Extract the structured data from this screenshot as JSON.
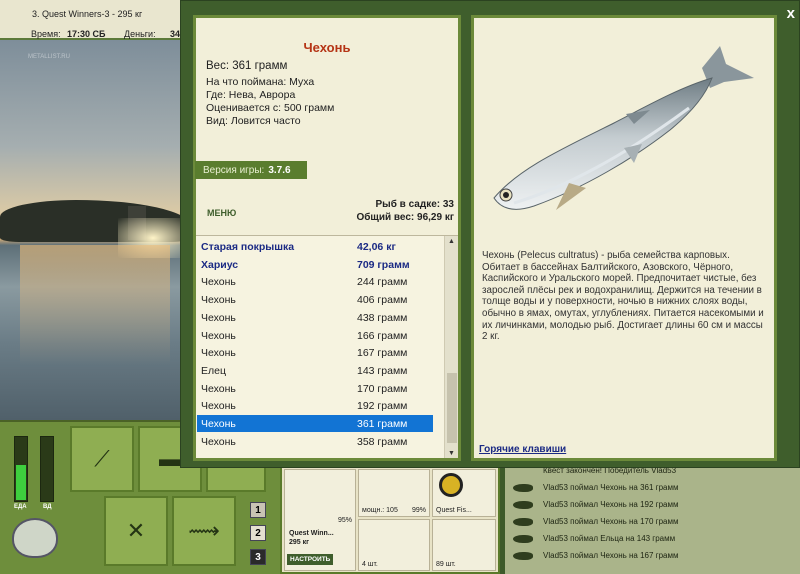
{
  "topbar": {
    "title": "3. Quest Winners-3 - 295 кг",
    "time_label": "Время:",
    "time_value": "17:30 СБ",
    "money_label": "Деньги:",
    "money_value": "34"
  },
  "scene": {
    "watermark": "METALLIST.RU"
  },
  "meters": {
    "energy_label": "ЕДА",
    "bait_label": "ВД",
    "energy_level": 0.55,
    "bait_level": 0.0,
    "energy_color": "#3ecf3e"
  },
  "dialog": {
    "close_label": "x",
    "fish": {
      "name": "Чехонь",
      "weight": "Вес: 361 грамм",
      "caught_on": "На что поймана: Муха",
      "location": "Где: Нева, Аврора",
      "value": "Оценивается с: 500 грамм",
      "type": "Вид: Ловится часто"
    },
    "version_label": "Версия игры:",
    "version_value": "3.7.6",
    "menu_label": "МЕНЮ",
    "cage_count": "Рыб в садке: 33",
    "cage_weight": "Общий вес: 96,29 кг",
    "catch_list": [
      {
        "name": "Старая покрышка",
        "weight": "42,06 кг",
        "special": true
      },
      {
        "name": "Хариус",
        "weight": "709 грамм",
        "special": true
      },
      {
        "name": "Чехонь",
        "weight": "244 грамм"
      },
      {
        "name": "Чехонь",
        "weight": "406 грамм"
      },
      {
        "name": "Чехонь",
        "weight": "438 грамм"
      },
      {
        "name": "Чехонь",
        "weight": "166 грамм"
      },
      {
        "name": "Чехонь",
        "weight": "167 грамм"
      },
      {
        "name": "Елец",
        "weight": "143 грамм"
      },
      {
        "name": "Чехонь",
        "weight": "170 грамм"
      },
      {
        "name": "Чехонь",
        "weight": "192 грамм"
      },
      {
        "name": "Чехонь",
        "weight": "361 грамм",
        "selected": true
      },
      {
        "name": "Чехонь",
        "weight": "358 грамм"
      }
    ],
    "description": "Чехонь (Pelecus cultratus) - рыба семейства карповых. Обитает в бассейнах Балтийского, Азовского, Чёрного, Каспийского и Уральского морей. Предпочитает чистые, без зарослей плёсы рек и водохранилищ. Держится на течении в толще воды и у поверхности, ночью в нижних слоях воды, обычно в ямах, омутах, углублениях. Питается насекомыми и их личинками, молодью рыб. Достигает длины 60 см и массы 2 кг.",
    "hotkeys_label": "Горячие клавиши"
  },
  "tackle": {
    "rod_percent": "95%",
    "rod_name": "Quest Winn...",
    "rod_weight": "295 кг",
    "setup_button": "НАСТРОИТЬ",
    "reel_power": "мощн.: 105",
    "reel_percent": "99%",
    "line_name": "Quest Fis...",
    "hook_count": "4 шт.",
    "bait_count": "89 шт."
  },
  "hud": {
    "num_buttons": [
      "1",
      "2",
      "3"
    ]
  },
  "log": [
    "Квест закончен! Победитель Vlad53",
    "Vlad53 поймал Чехонь на 361 грамм",
    "Vlad53 поймал Чехонь на 192 грамм",
    "Vlad53 поймал Чехонь на 170 грамм",
    "Vlad53 поймал Ельца на 143 грамм",
    "Vlad53 поймал Чехонь на 167 грамм"
  ]
}
